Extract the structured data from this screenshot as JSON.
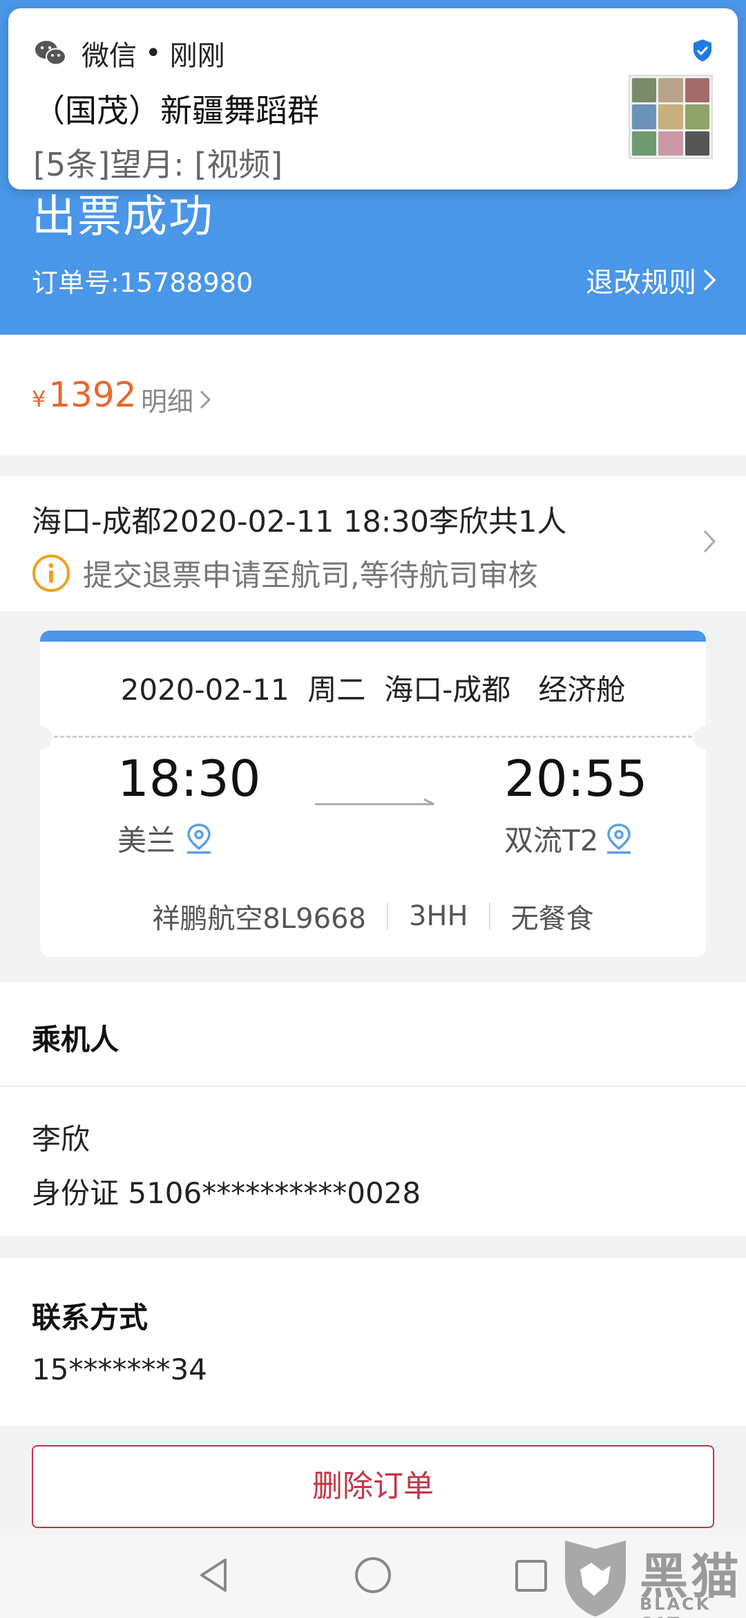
{
  "notification": {
    "app": "微信",
    "separator": "•",
    "time": "刚刚",
    "group": "（国茂）新疆舞蹈群",
    "message": "[5条]望月: [视频]",
    "icon": "wechat-icon"
  },
  "header": {
    "title": "出票成功",
    "order_number": "订单号:15788980",
    "rules_link": "退改规则",
    "color": "#4a96e8"
  },
  "price": {
    "currency": "¥",
    "amount": "1392",
    "detail_link": "明细",
    "color": "#e8672c"
  },
  "trip": {
    "summary": "海口-成都2020-02-11 18:30李欣共1人",
    "status": "提交退票申请至航司,等待航司审核",
    "status_icon": "info-icon"
  },
  "ticket": {
    "info": "2020-02-11  周二  海口-成都   经济舱",
    "departure_time": "18:30",
    "departure_airport": "美兰",
    "arrival_time": "20:55",
    "arrival_airport": "双流T2",
    "flight": "祥鹏航空8L9668",
    "cabin_code": "3HH",
    "meal": "无餐食"
  },
  "passenger": {
    "heading": "乘机人",
    "name": "李欣",
    "id_label": "身份证  5106**********0028"
  },
  "contact": {
    "heading": "联系方式",
    "phone": "15*******34"
  },
  "actions": {
    "delete": "删除订单"
  },
  "watermark": {
    "cn": "黑猫",
    "en": "BLACK CAT"
  }
}
